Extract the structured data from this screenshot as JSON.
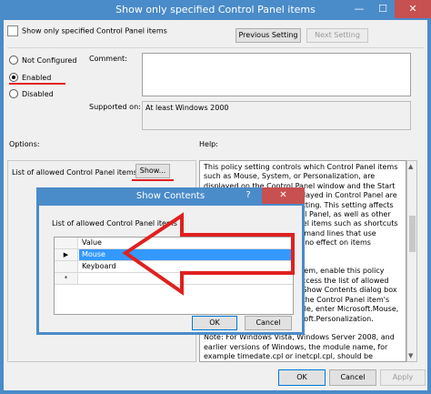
{
  "window": {
    "title": "Show only specified Control Panel items",
    "minimize": "—",
    "maximize": "☐",
    "close": "✕"
  },
  "header": {
    "setting_name": "Show only specified Control Panel items",
    "prev_button": "Previous Setting",
    "next_button": "Next Setting"
  },
  "state": {
    "options": [
      "Not Configured",
      "Enabled",
      "Disabled"
    ],
    "selected": "Enabled"
  },
  "comment_label": "Comment:",
  "supported_label": "Supported on:",
  "supported_value": "At least Windows 2000",
  "options_label": "Options:",
  "help_label": "Help:",
  "options_panel": {
    "list_label": "List of allowed Control Panel items",
    "show_button": "Show..."
  },
  "help_text": "This policy setting controls which Control Panel items such as Mouse, System, or Personalization, are displayed on the Control Panel window and the Start screen. The only items displayed in Control Panel are those you specify in this setting. This setting affects the Start screen and Control Panel, as well as other ways to access Control Panel items such as shortcuts in Help and Support or command lines that use control.exe. This policy has no effect on items displayed in PC settings.\n\nTo display a Control Panel item, enable this policy setting and click Show to access the list of allowed Control Panel items. In the Show Contents dialog box in the Value column, enter the Control Panel item's canonical name. For example, enter Microsoft.Mouse, Microsoft.System, or Microsoft.Personalization.\n\nNote: For Windows Vista, Windows Server 2008, and earlier versions of Windows, the module name, for example timedate.cpl or inetcpl.cpl, should be entered. If a Control Panel item does not have a CPL file, or the CPL file contains multiple applets, then its module name and string resource identification",
  "footer": {
    "ok": "OK",
    "cancel": "Cancel",
    "apply": "Apply"
  },
  "dialog": {
    "title": "Show Contents",
    "help": "?",
    "close": "✕",
    "list_label": "List of allowed Control Panel items",
    "column_header": "Value",
    "rows": [
      {
        "marker": "▶",
        "value": "Mouse"
      },
      {
        "marker": "",
        "value": "Keyboard"
      },
      {
        "marker": "*",
        "value": ""
      }
    ],
    "ok": "OK",
    "cancel": "Cancel"
  },
  "annotation_color": "#e02020"
}
